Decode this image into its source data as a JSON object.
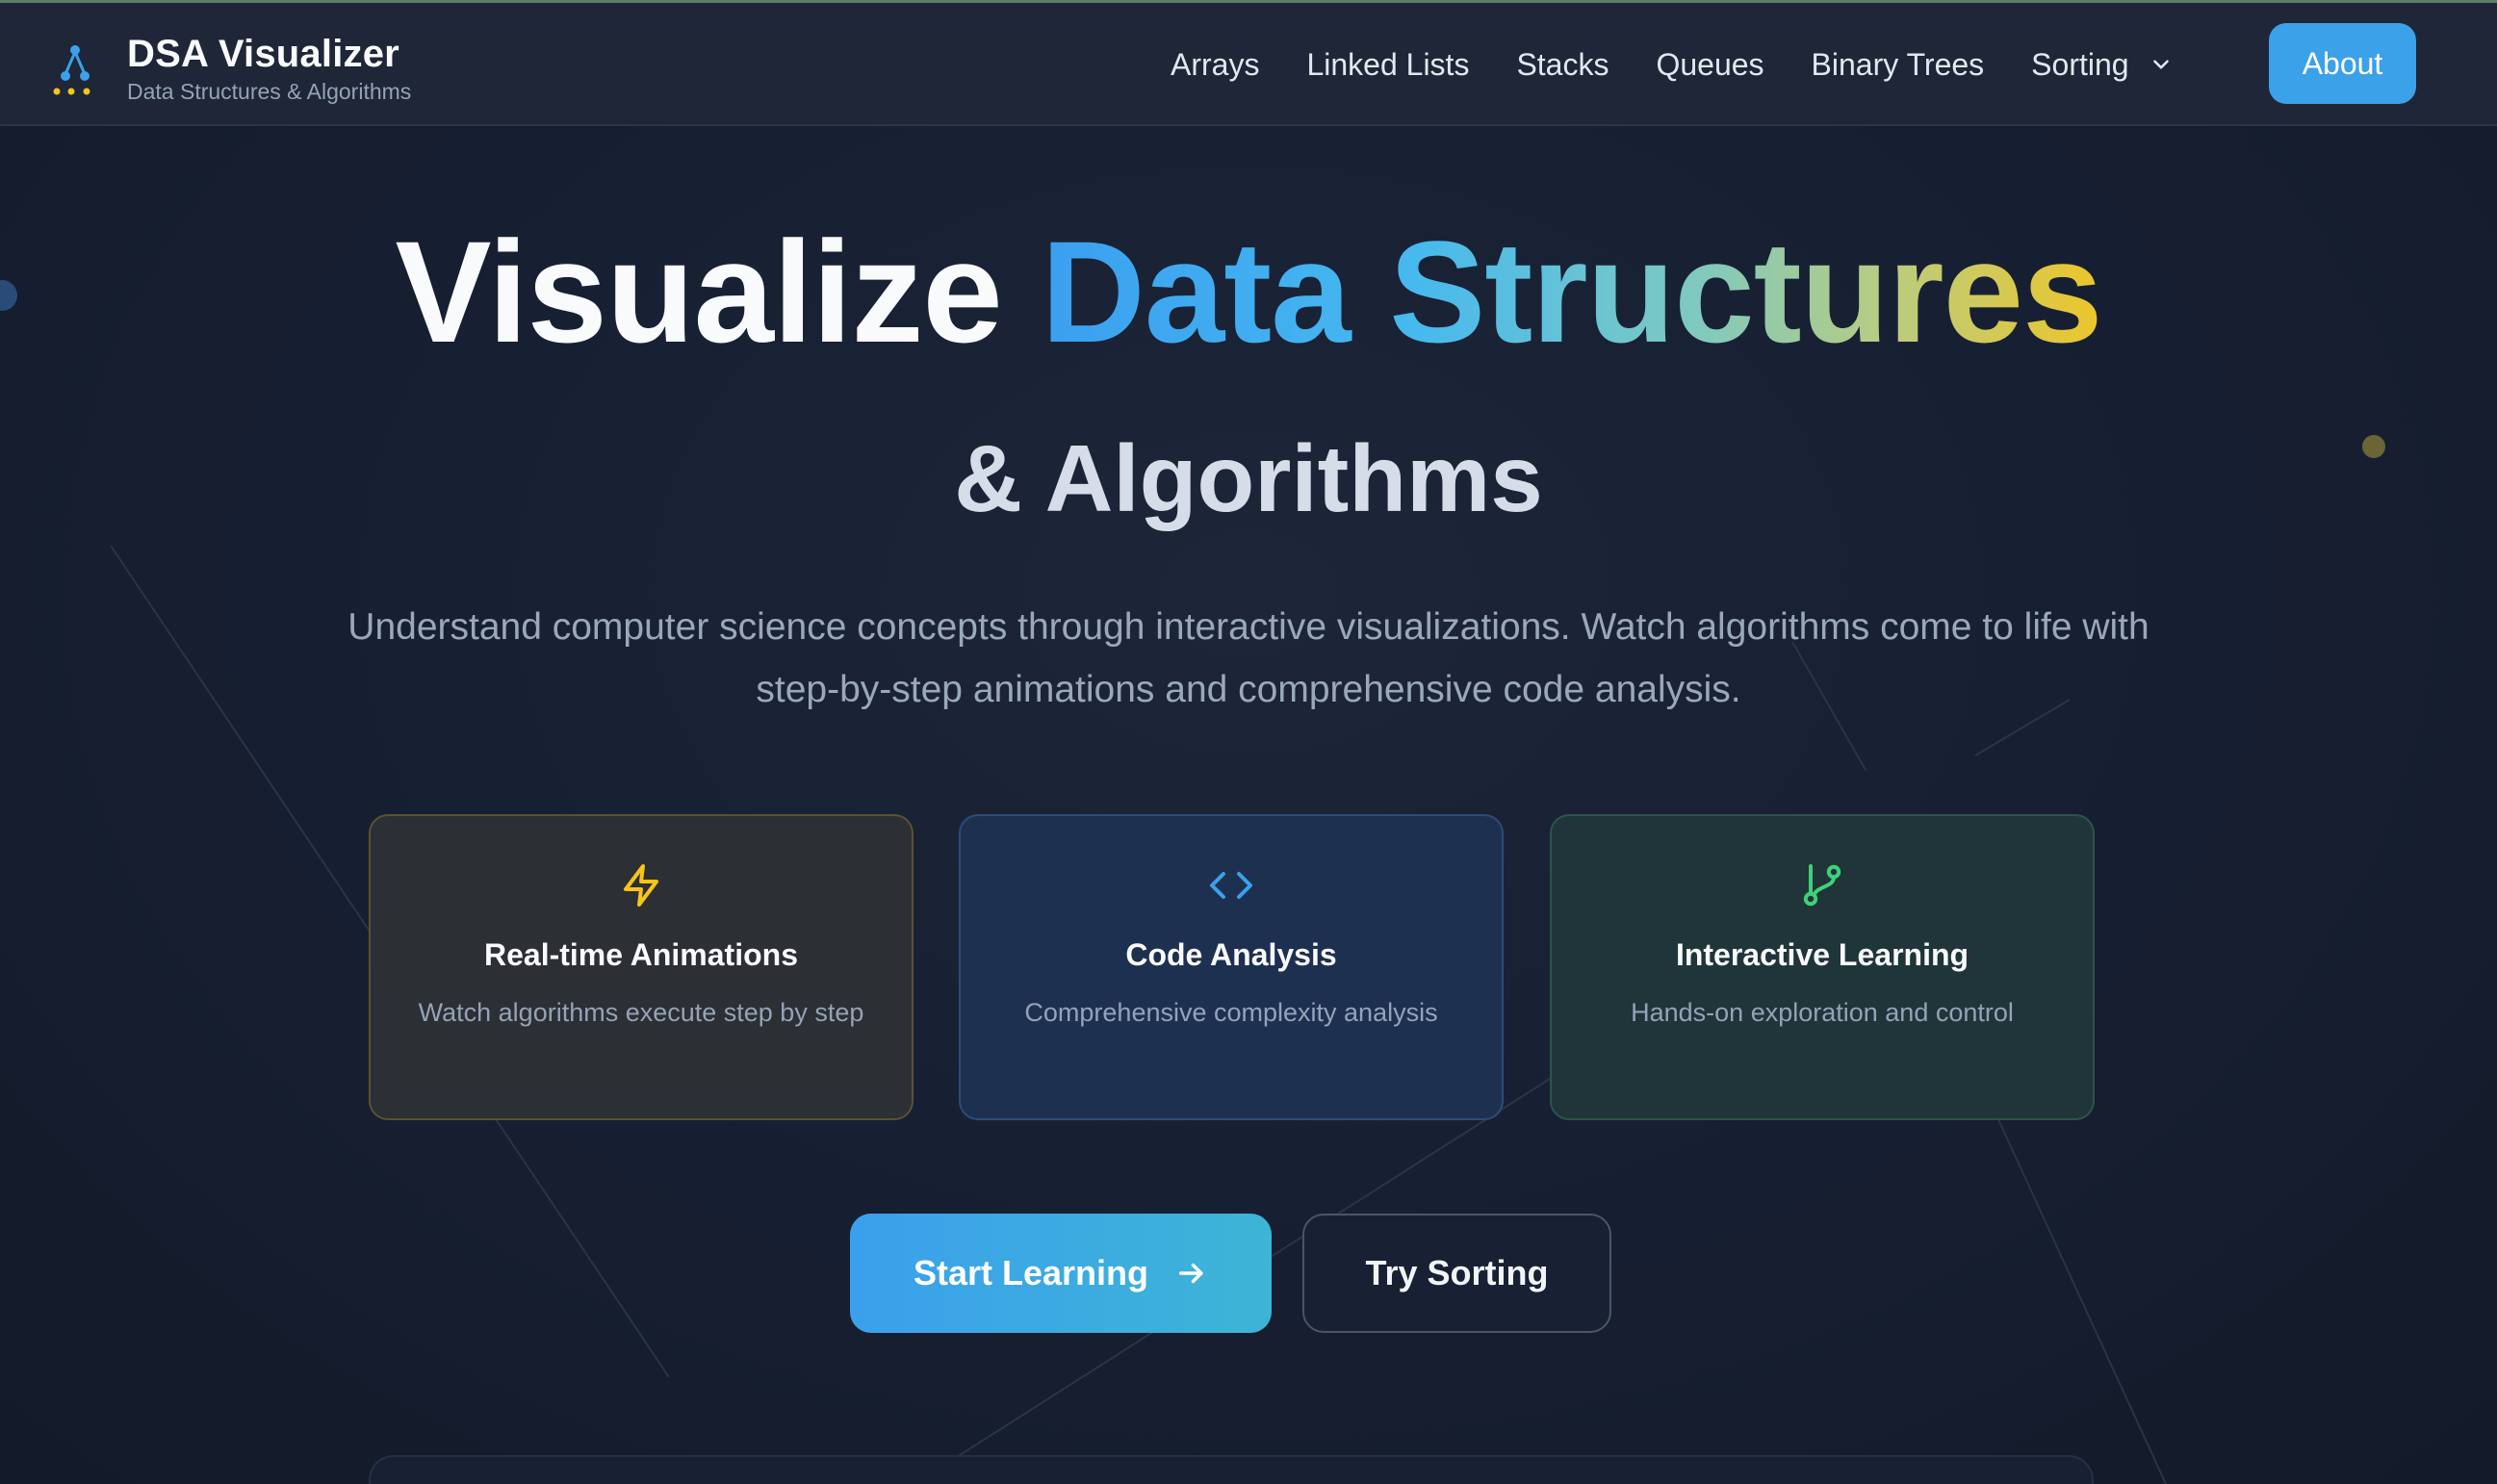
{
  "brand": {
    "title": "DSA Visualizer",
    "subtitle": "Data Structures & Algorithms",
    "logo_icon": "tree-graph-icon"
  },
  "nav": {
    "links": [
      "Arrays",
      "Linked Lists",
      "Stacks",
      "Queues",
      "Binary Trees"
    ],
    "dropdown_label": "Sorting",
    "about_label": "About"
  },
  "hero": {
    "title_plain": "Visualize",
    "title_highlight": "Data Structures",
    "subtitle": "& Algorithms",
    "description": "Understand computer science concepts through interactive visualizations. Watch algorithms come to life with step-by-step animations and comprehensive code analysis."
  },
  "features": [
    {
      "icon": "lightning-bolt-icon",
      "title": "Real-time Animations",
      "description": "Watch algorithms execute step by step",
      "accent": "#f5c518"
    },
    {
      "icon": "code-brackets-icon",
      "title": "Code Analysis",
      "description": "Comprehensive complexity analysis",
      "accent": "#3ba1e8"
    },
    {
      "icon": "git-branch-icon",
      "title": "Interactive Learning",
      "description": "Hands-on exploration and control",
      "accent": "#3fd07a"
    }
  ],
  "cta": {
    "primary_label": "Start Learning",
    "secondary_label": "Try Sorting"
  },
  "colors": {
    "accent_blue": "#3ba1e8",
    "accent_yellow": "#f5c518",
    "background": "#172033",
    "nav_background": "#1e2637"
  }
}
